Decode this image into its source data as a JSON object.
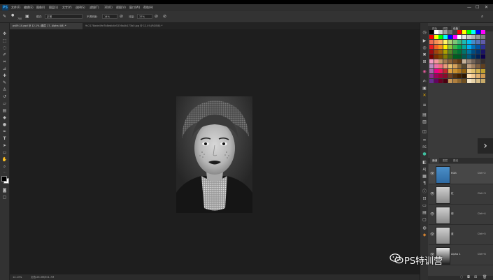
{
  "app": {
    "logo": "PS"
  },
  "menu": [
    "文件(F)",
    "编辑(E)",
    "图像(I)",
    "图层(L)",
    "文字(Y)",
    "选择(S)",
    "滤镜(T)",
    "3D(D)",
    "视图(V)",
    "窗口(W)",
    "帮助(H)"
  ],
  "window_controls": [
    "—",
    "☐",
    "✕"
  ],
  "options": {
    "brush_size": "700",
    "mode_label": "模式:",
    "mode_value": "正常",
    "opacity_label": "不透明度:",
    "opacity_value": "14%",
    "flow_label": "流量:",
    "flow_value": "37%"
  },
  "tabs": [
    {
      "label": "ps09-10.psd @ 12.1% (图层 17, Alpha 4/8) *",
      "active": true
    },
    {
      "label": "9c2178ade49e7b8ebb4e5236a4b173b0.jpg @ 12.4%(RGB/8) *",
      "active": false
    }
  ],
  "status": {
    "zoom": "12.13%",
    "doc": "文档:26.3M/301.7M"
  },
  "panels": {
    "top_tabs": [
      "颜色",
      "调整",
      "色板"
    ],
    "top_active": 2,
    "layer_tabs": [
      "通道",
      "图层",
      "路径"
    ],
    "layer_active": 0
  },
  "channels": [
    {
      "name": "RGB",
      "shortcut": "Ctrl+2"
    },
    {
      "name": "红",
      "shortcut": "Ctrl+3"
    },
    {
      "name": "绿",
      "shortcut": "Ctrl+4"
    },
    {
      "name": "蓝",
      "shortcut": "Ctrl+5"
    },
    {
      "name": "Alpha 1",
      "shortcut": "Ctrl+6"
    }
  ],
  "watermark": {
    "text": "PS特训营"
  },
  "colors": {
    "accent": "#31a8ff",
    "bg": "#282828"
  }
}
